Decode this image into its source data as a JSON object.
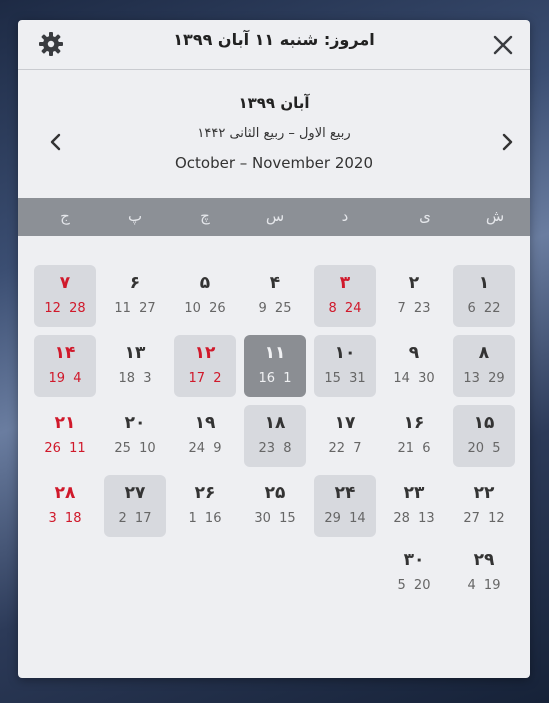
{
  "header": {
    "today_title": "امروز: شنبه ۱۱ آبان ۱۳۹۹",
    "settings_icon": "gear-icon",
    "close_icon": "close-icon"
  },
  "month": {
    "title": "آبان ۱۳۹۹",
    "hijri": "ربیع الاول – ربیع الثانی ۱۴۴۲",
    "gregorian": "October – November 2020"
  },
  "weekdays": [
    "ش",
    "ی",
    "د",
    "س",
    "چ",
    "پ",
    "ج"
  ],
  "colors": {
    "holiday_red": "#d0192b",
    "weekbar": "#8c9096",
    "today_bg": "#8b8e93"
  },
  "weeks": [
    [
      {
        "p": "۱",
        "s": "6 22",
        "red": false,
        "holiday": true,
        "today": false
      },
      {
        "p": "۲",
        "s": "7 23",
        "red": false,
        "holiday": false,
        "today": false
      },
      {
        "p": "۳",
        "s": "8 24",
        "red": true,
        "holiday": true,
        "today": false
      },
      {
        "p": "۴",
        "s": "9 25",
        "red": false,
        "holiday": false,
        "today": false
      },
      {
        "p": "۵",
        "s": "10 26",
        "red": false,
        "holiday": false,
        "today": false
      },
      {
        "p": "۶",
        "s": "11 27",
        "red": false,
        "holiday": false,
        "today": false
      },
      {
        "p": "۷",
        "s": "12 28",
        "red": true,
        "holiday": true,
        "today": false
      }
    ],
    [
      {
        "p": "۸",
        "s": "13 29",
        "red": false,
        "holiday": true,
        "today": false
      },
      {
        "p": "۹",
        "s": "14 30",
        "red": false,
        "holiday": false,
        "today": false
      },
      {
        "p": "۱۰",
        "s": "15 31",
        "red": false,
        "holiday": true,
        "today": false
      },
      {
        "p": "۱۱",
        "s": "16 1",
        "red": false,
        "holiday": false,
        "today": true
      },
      {
        "p": "۱۲",
        "s": "17 2",
        "red": true,
        "holiday": true,
        "today": false
      },
      {
        "p": "۱۳",
        "s": "18 3",
        "red": false,
        "holiday": false,
        "today": false
      },
      {
        "p": "۱۴",
        "s": "19 4",
        "red": true,
        "holiday": true,
        "today": false
      }
    ],
    [
      {
        "p": "۱۵",
        "s": "20 5",
        "red": false,
        "holiday": true,
        "today": false
      },
      {
        "p": "۱۶",
        "s": "21 6",
        "red": false,
        "holiday": false,
        "today": false
      },
      {
        "p": "۱۷",
        "s": "22 7",
        "red": false,
        "holiday": false,
        "today": false
      },
      {
        "p": "۱۸",
        "s": "23 8",
        "red": false,
        "holiday": true,
        "today": false
      },
      {
        "p": "۱۹",
        "s": "24 9",
        "red": false,
        "holiday": false,
        "today": false
      },
      {
        "p": "۲۰",
        "s": "25 10",
        "red": false,
        "holiday": false,
        "today": false
      },
      {
        "p": "۲۱",
        "s": "26 11",
        "red": true,
        "holiday": false,
        "today": false
      }
    ],
    [
      {
        "p": "۲۲",
        "s": "27 12",
        "red": false,
        "holiday": false,
        "today": false
      },
      {
        "p": "۲۳",
        "s": "28 13",
        "red": false,
        "holiday": false,
        "today": false
      },
      {
        "p": "۲۴",
        "s": "29 14",
        "red": false,
        "holiday": true,
        "today": false
      },
      {
        "p": "۲۵",
        "s": "30 15",
        "red": false,
        "holiday": false,
        "today": false
      },
      {
        "p": "۲۶",
        "s": "1 16",
        "red": false,
        "holiday": false,
        "today": false
      },
      {
        "p": "۲۷",
        "s": "2 17",
        "red": false,
        "holiday": true,
        "today": false
      },
      {
        "p": "۲۸",
        "s": "3 18",
        "red": true,
        "holiday": false,
        "today": false
      }
    ],
    [
      {
        "p": "۲۹",
        "s": "4 19",
        "red": false,
        "holiday": false,
        "today": false
      },
      {
        "p": "۳۰",
        "s": "5 20",
        "red": false,
        "holiday": false,
        "today": false
      }
    ]
  ]
}
